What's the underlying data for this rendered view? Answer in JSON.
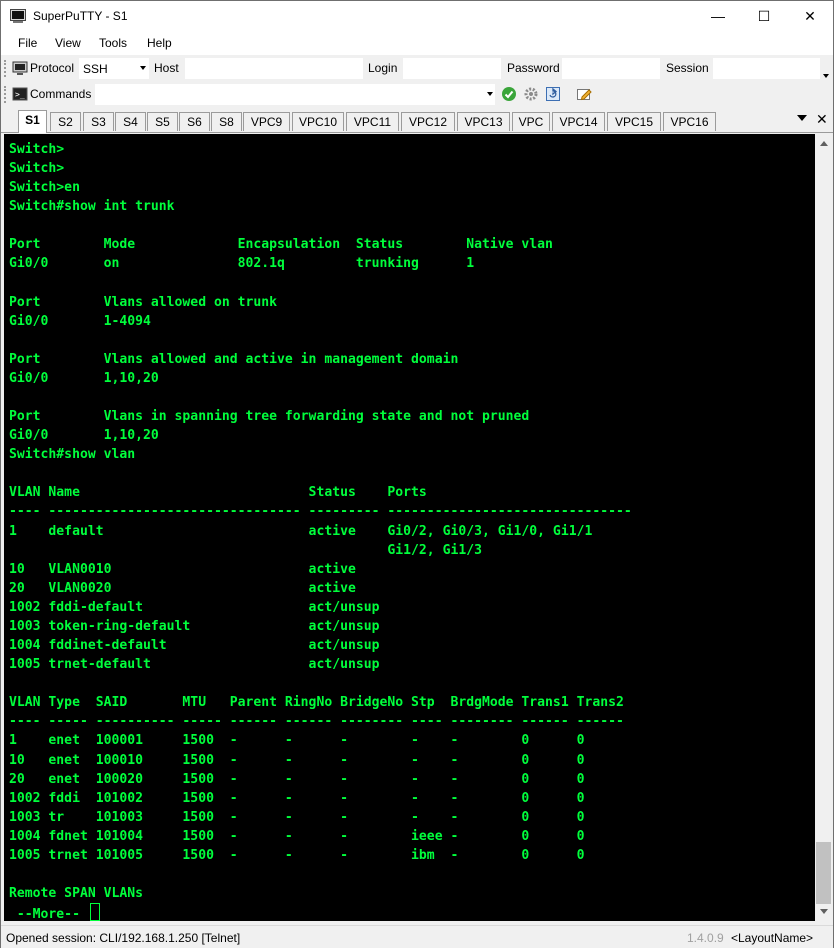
{
  "window": {
    "title": "SuperPuTTY - S1",
    "minimize": "—",
    "maximize": "☐",
    "close": "✕"
  },
  "menu": [
    "File",
    "View",
    "Tools",
    "Help"
  ],
  "toolbar1": {
    "protocol_label": "Protocol",
    "protocol_value": "SSH",
    "host_label": "Host",
    "login_label": "Login",
    "password_label": "Password",
    "session_label": "Session"
  },
  "toolbar2": {
    "commands_label": "Commands"
  },
  "tabs": [
    "S1",
    "S2",
    "S3",
    "S4",
    "S5",
    "S6",
    "S8",
    "VPC9",
    "VPC10",
    "VPC11",
    "VPC12",
    "VPC13",
    "VPC",
    "VPC14",
    "VPC15",
    "VPC16"
  ],
  "active_tab": "S1",
  "terminal": {
    "lines": [
      "Switch>",
      "Switch>",
      "Switch>en",
      "Switch#show int trunk",
      "",
      "Port        Mode             Encapsulation  Status        Native vlan",
      "Gi0/0       on               802.1q         trunking      1",
      "",
      "Port        Vlans allowed on trunk",
      "Gi0/0       1-4094",
      "",
      "Port        Vlans allowed and active in management domain",
      "Gi0/0       1,10,20",
      "",
      "Port        Vlans in spanning tree forwarding state and not pruned",
      "Gi0/0       1,10,20",
      "Switch#show vlan",
      "",
      "VLAN Name                             Status    Ports",
      "---- -------------------------------- --------- -------------------------------",
      "1    default                          active    Gi0/2, Gi0/3, Gi1/0, Gi1/1",
      "                                                Gi1/2, Gi1/3",
      "10   VLAN0010                         active",
      "20   VLAN0020                         active",
      "1002 fddi-default                     act/unsup",
      "1003 token-ring-default               act/unsup",
      "1004 fddinet-default                  act/unsup",
      "1005 trnet-default                    act/unsup",
      "",
      "VLAN Type  SAID       MTU   Parent RingNo BridgeNo Stp  BrdgMode Trans1 Trans2",
      "---- ----- ---------- ----- ------ ------ -------- ---- -------- ------ ------",
      "1    enet  100001     1500  -      -      -        -    -        0      0",
      "10   enet  100010     1500  -      -      -        -    -        0      0",
      "20   enet  100020     1500  -      -      -        -    -        0      0",
      "1002 fddi  101002     1500  -      -      -        -    -        0      0",
      "1003 tr    101003     1500  -      -      -        -    -        0      0",
      "1004 fdnet 101004     1500  -      -      -        ieee -        0      0",
      "1005 trnet 101005     1500  -      -      -        ibm  -        0      0",
      "",
      "Remote SPAN VLANs"
    ],
    "prompt": " --More-- "
  },
  "status": {
    "text": "Opened session: CLI/192.168.1.250 [Telnet]",
    "version": "1.4.0.9",
    "layout": "<LayoutName>"
  }
}
